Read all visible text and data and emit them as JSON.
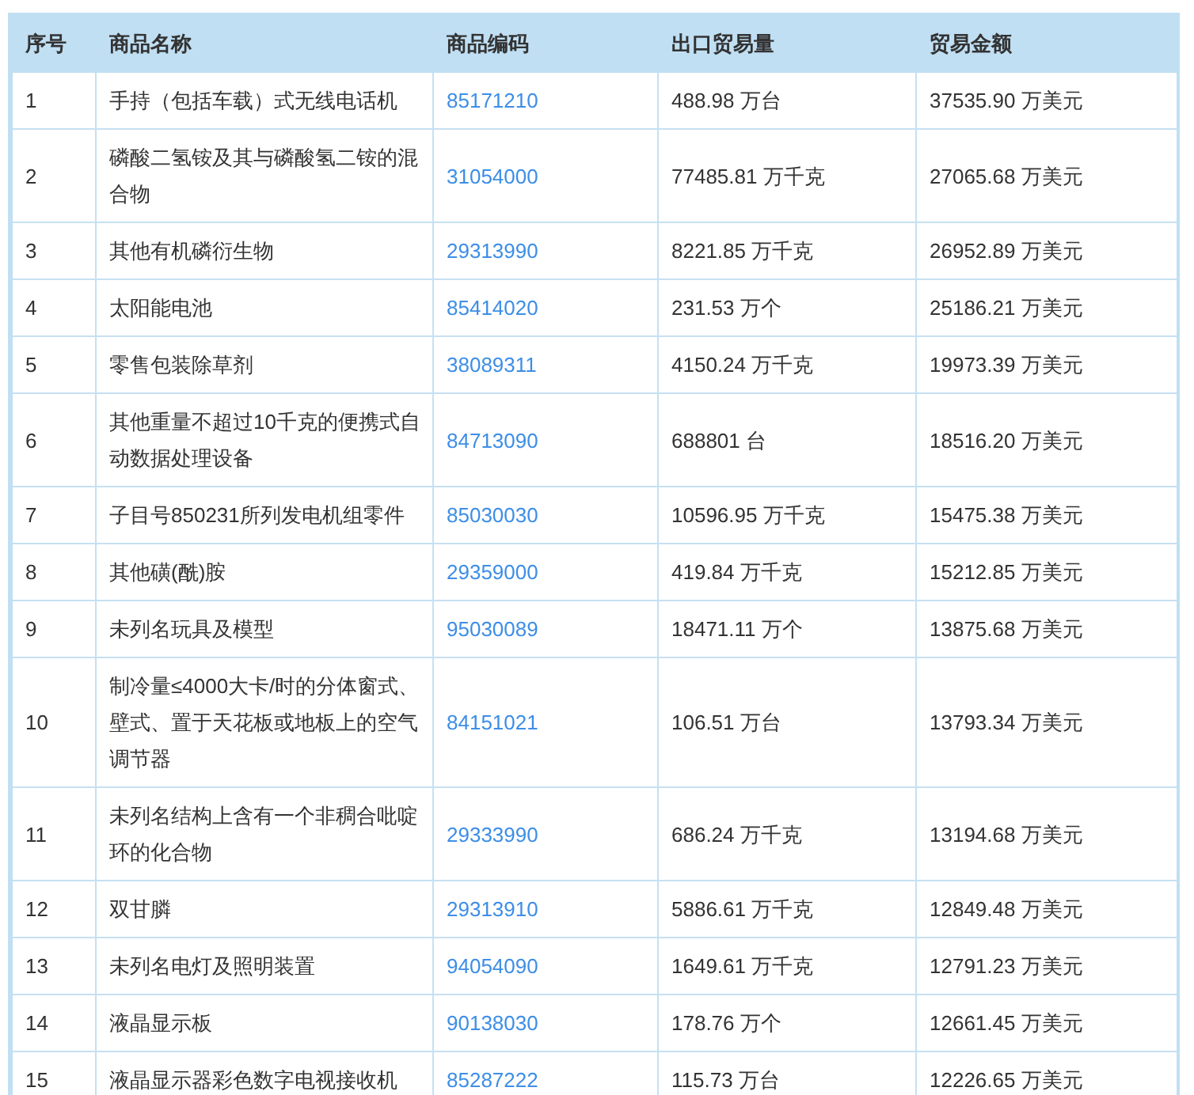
{
  "table": {
    "columns": [
      "序号",
      "商品名称",
      "商品编码",
      "出口贸易量",
      "贸易金额"
    ],
    "rows": [
      {
        "no": "1",
        "name": "手持（包括车载）式无线电话机",
        "code": "85171210",
        "volume": "488.98 万台",
        "amount": "37535.90 万美元"
      },
      {
        "no": "2",
        "name": "磷酸二氢铵及其与磷酸氢二铵的混合物",
        "code": "31054000",
        "volume": "77485.81 万千克",
        "amount": "27065.68 万美元"
      },
      {
        "no": "3",
        "name": "其他有机磷衍生物",
        "code": "29313990",
        "volume": "8221.85 万千克",
        "amount": "26952.89 万美元"
      },
      {
        "no": "4",
        "name": "太阳能电池",
        "code": "85414020",
        "volume": "231.53 万个",
        "amount": "25186.21 万美元"
      },
      {
        "no": "5",
        "name": "零售包装除草剂",
        "code": "38089311",
        "volume": "4150.24 万千克",
        "amount": "19973.39 万美元"
      },
      {
        "no": "6",
        "name": "其他重量不超过10千克的便携式自动数据处理设备",
        "code": "84713090",
        "volume": "688801 台",
        "amount": "18516.20 万美元"
      },
      {
        "no": "7",
        "name": "子目号850231所列发电机组零件",
        "code": "85030030",
        "volume": "10596.95 万千克",
        "amount": "15475.38 万美元"
      },
      {
        "no": "8",
        "name": "其他磺(酰)胺",
        "code": "29359000",
        "volume": "419.84 万千克",
        "amount": "15212.85 万美元"
      },
      {
        "no": "9",
        "name": "未列名玩具及模型",
        "code": "95030089",
        "volume": "18471.11 万个",
        "amount": "13875.68 万美元"
      },
      {
        "no": "10",
        "name": "制冷量≤4000大卡/时的分体窗式、壁式、置于天花板或地板上的空气调节器",
        "code": "84151021",
        "volume": "106.51 万台",
        "amount": "13793.34 万美元"
      },
      {
        "no": "11",
        "name": "未列名结构上含有一个非稠合吡啶环的化合物",
        "code": "29333990",
        "volume": "686.24 万千克",
        "amount": "13194.68 万美元"
      },
      {
        "no": "12",
        "name": "双甘膦",
        "code": "29313910",
        "volume": "5886.61 万千克",
        "amount": "12849.48 万美元"
      },
      {
        "no": "13",
        "name": "未列名电灯及照明装置",
        "code": "94054090",
        "volume": "1649.61 万千克",
        "amount": "12791.23 万美元"
      },
      {
        "no": "14",
        "name": "液晶显示板",
        "code": "90138030",
        "volume": "178.76 万个",
        "amount": "12661.45 万美元"
      },
      {
        "no": "15",
        "name": "液晶显示器彩色数字电视接收机",
        "code": "85287222",
        "volume": "115.73 万台",
        "amount": "12226.65 万美元"
      }
    ]
  }
}
